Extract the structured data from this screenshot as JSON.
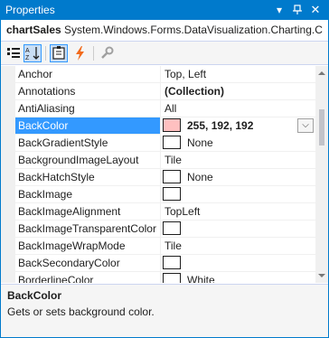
{
  "window": {
    "title": "Properties",
    "dropdown_glyph": "▾",
    "pin_glyph": "⊥",
    "close_glyph": "✕"
  },
  "object_selector": {
    "name": "chartSales",
    "type": "System.Windows.Forms.DataVisualization.Charting.C"
  },
  "toolbar": {
    "tools": [
      {
        "name": "categorized-icon",
        "active": false
      },
      {
        "name": "alphabetical-icon",
        "active": true
      },
      {
        "name": "properties-icon",
        "active": true
      },
      {
        "name": "events-icon",
        "active": false
      },
      {
        "name": "property-pages-icon",
        "active": false
      }
    ]
  },
  "properties": [
    {
      "name": "Anchor",
      "value": "Top, Left",
      "kind": "text"
    },
    {
      "name": "Annotations",
      "value": "(Collection)",
      "kind": "bold"
    },
    {
      "name": "AntiAliasing",
      "value": "All",
      "kind": "text"
    },
    {
      "name": "BackColor",
      "value": "255, 192, 192",
      "kind": "color",
      "color": "#ffc0c0",
      "selected": true
    },
    {
      "name": "BackGradientStyle",
      "value": "None",
      "kind": "color",
      "color": "#ffffff"
    },
    {
      "name": "BackgroundImageLayout",
      "value": "Tile",
      "kind": "text"
    },
    {
      "name": "BackHatchStyle",
      "value": "None",
      "kind": "color",
      "color": "#ffffff"
    },
    {
      "name": "BackImage",
      "value": "",
      "kind": "color",
      "color": "#ffffff"
    },
    {
      "name": "BackImageAlignment",
      "value": "TopLeft",
      "kind": "text"
    },
    {
      "name": "BackImageTransparentColor",
      "value": "",
      "kind": "color",
      "color": "#ffffff"
    },
    {
      "name": "BackImageWrapMode",
      "value": "Tile",
      "kind": "text"
    },
    {
      "name": "BackSecondaryColor",
      "value": "",
      "kind": "color",
      "color": "#ffffff"
    },
    {
      "name": "BorderlineColor",
      "value": "White",
      "kind": "color",
      "color": "#ffffff"
    }
  ],
  "dropdown_button_glyph": "⌵",
  "description": {
    "title": "BackColor",
    "text": "Gets or sets background color."
  },
  "colors": {
    "accent": "#007acc",
    "selection": "#3399ff",
    "backcolor_swatch": "#ffc0c0"
  }
}
